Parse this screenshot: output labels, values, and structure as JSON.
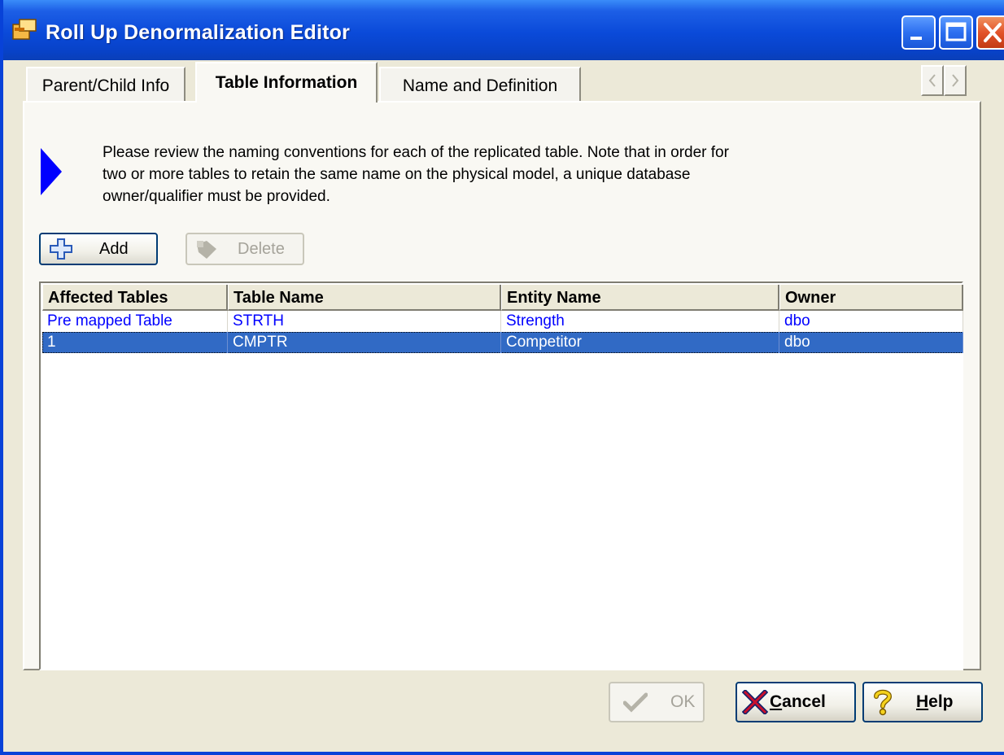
{
  "window": {
    "title": "Roll Up Denormalization Editor",
    "icon": "editor-icon",
    "controls": {
      "minimize": "minimize-icon",
      "maximize": "maximize-icon",
      "close": "close-icon"
    }
  },
  "tabs": [
    {
      "label": "Parent/Child Info",
      "active": false
    },
    {
      "label": "Table Information",
      "active": true
    },
    {
      "label": "Name and Definition",
      "active": false
    }
  ],
  "description": "Please review the naming conventions for each of the replicated table. Note that in order for two or more tables to retain the same name on the physical model, a unique database owner/qualifier must be provided.",
  "toolbar": {
    "add_label": "Add",
    "add_icon": "plus-icon",
    "delete_label": "Delete",
    "delete_icon": "delete-icon",
    "delete_enabled": false
  },
  "grid": {
    "columns": [
      "Affected Tables",
      "Table Name",
      "Entity Name",
      "Owner"
    ],
    "rows": [
      {
        "affected": "Pre mapped Table",
        "table_name": "STRTH",
        "entity_name": "Strength",
        "owner": "dbo",
        "selected": false
      },
      {
        "affected": "1",
        "table_name": "CMPTR",
        "entity_name": "Competitor",
        "owner": "dbo",
        "selected": true
      }
    ]
  },
  "buttons": {
    "ok": {
      "label": "OK",
      "enabled": false,
      "icon": "checkmark-icon"
    },
    "cancel": {
      "prefix": "C",
      "label": "ancel",
      "icon": "x-icon"
    },
    "help": {
      "prefix": "H",
      "label": "elp",
      "icon": "question-icon"
    }
  },
  "colors": {
    "titlebar": "#0a4ad9",
    "selection": "#316ac5",
    "link_text": "#0000ff",
    "dialog_bg": "#ece9d8"
  }
}
